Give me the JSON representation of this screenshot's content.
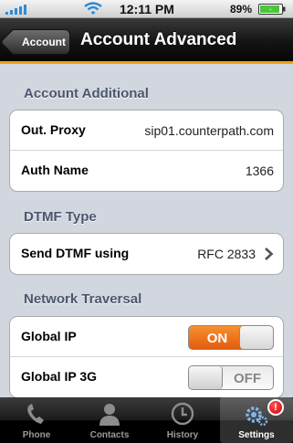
{
  "status_bar": {
    "time": "12:11 PM",
    "battery": "89%"
  },
  "nav": {
    "back_label": "Account",
    "title": "Account Advanced"
  },
  "sections": {
    "account_additional": {
      "header": "Account Additional",
      "out_proxy_label": "Out. Proxy",
      "out_proxy_value": "sip01.counterpath.com",
      "auth_name_label": "Auth Name",
      "auth_name_value": "1366"
    },
    "dtmf": {
      "header": "DTMF Type",
      "send_label": "Send DTMF using",
      "send_value": "RFC 2833"
    },
    "network": {
      "header": "Network Traversal",
      "global_ip_label": "Global IP",
      "global_ip_state": "ON",
      "global_ip_3g_label": "Global IP 3G",
      "global_ip_3g_state": "OFF"
    }
  },
  "tabs": {
    "phone": "Phone",
    "contacts": "Contacts",
    "history": "History",
    "settings": "Settings",
    "settings_badge": "!"
  },
  "colors": {
    "accent": "#f0a316",
    "toggle_on": "#ee7a1f",
    "group_header": "#4c566c",
    "background": "#d2d7df"
  }
}
